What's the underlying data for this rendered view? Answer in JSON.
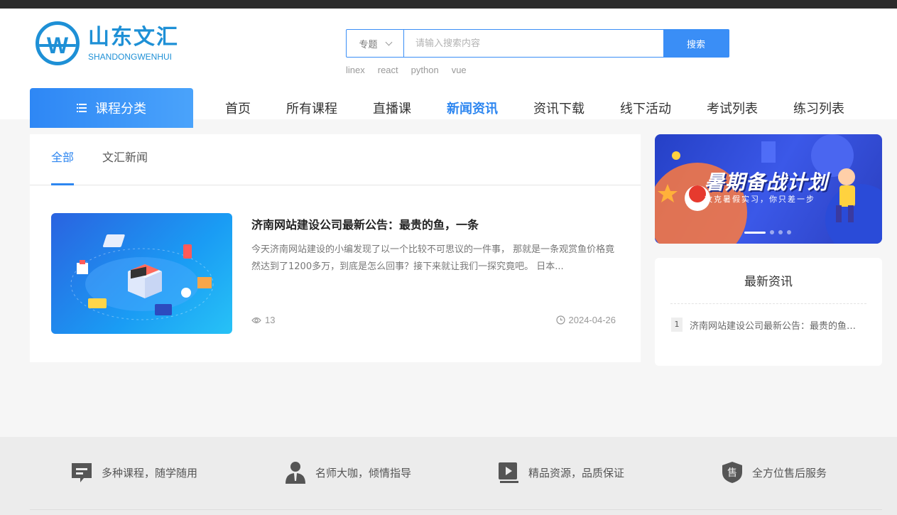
{
  "header": {
    "logo_cn": "山东文汇",
    "logo_en": "SHANDONGWENHUI",
    "logo_letter": "W"
  },
  "search": {
    "select_value": "专题",
    "placeholder": "请输入搜索内容",
    "button_label": "搜索",
    "hotwords": [
      "linex",
      "react",
      "python",
      "vue"
    ]
  },
  "nav": {
    "category_label": "课程分类",
    "items": [
      "首页",
      "所有课程",
      "直播课",
      "新闻资讯",
      "资讯下载",
      "线下活动",
      "考试列表",
      "练习列表"
    ],
    "active_index": 3
  },
  "tabs": [
    "全部",
    "文汇新闻"
  ],
  "article": {
    "title": "济南网站建设公司最新公告：最贵的鱼，一条",
    "desc": "今天济南网站建设的小编发现了以一个比较不可思议的一件事， 那就是一条观赏鱼价格竟然达到了1200多万，到底是怎么回事？接下来就让我们一探究竟吧。 日本...",
    "views": "13",
    "date": "2024-04-26"
  },
  "banner": {
    "title": "暑期备战计划",
    "subtitle": "攻克暑假实习，你只差一步"
  },
  "latest": {
    "title": "最新资讯",
    "items": [
      {
        "rank": "1",
        "text": "济南网站建设公司最新公告：最贵的鱼，一条"
      }
    ]
  },
  "footer": {
    "features": [
      "多种课程，随学随用",
      "名师大咖，倾情指导",
      "精品资源，品质保证",
      "全方位售后服务"
    ]
  },
  "colors": {
    "accent": "#2d86f0",
    "brand": "#1e90d6"
  }
}
